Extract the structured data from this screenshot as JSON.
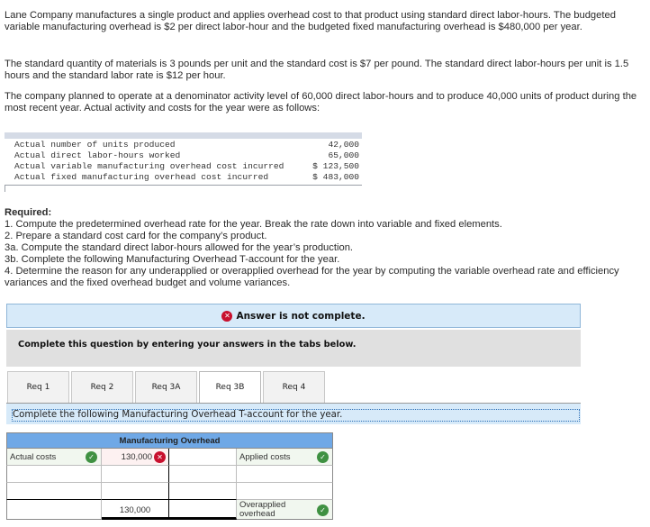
{
  "problem": {
    "paragraphs": [
      "Lane Company manufactures a single product and applies overhead cost to that product using standard direct labor-hours. The budgeted variable manufacturing overhead is $2 per direct labor-hour and the budgeted fixed manufacturing overhead is $480,000 per year.",
      "The standard quantity of materials is 3 pounds per unit and the standard cost is $7 per pound. The standard direct labor-hours per unit is 1.5 hours and the standard labor rate is $12 per hour.",
      "The company planned to operate at a denominator activity level of 60,000 direct labor-hours and to produce 40,000 units of product during the most recent year. Actual activity and costs for the year were as follows:"
    ],
    "actuals": [
      {
        "label": "Actual number of units produced",
        "value": "42,000"
      },
      {
        "label": "Actual direct labor-hours worked",
        "value": "65,000"
      },
      {
        "label": "Actual variable manufacturing overhead cost incurred",
        "value": "$ 123,500"
      },
      {
        "label": "Actual fixed manufacturing overhead cost incurred",
        "value": "$ 483,000"
      }
    ],
    "required": {
      "heading": "Required:",
      "items": [
        "1. Compute the predetermined overhead rate for the year. Break the rate down into variable and fixed elements.",
        "2. Prepare a standard cost card for the company’s product.",
        "3a. Compute the standard direct labor-hours allowed for the year’s production.",
        "3b. Complete the following Manufacturing Overhead T-account for the year.",
        "4. Determine the reason for any underapplied or overapplied overhead for the year by computing the variable overhead rate and efficiency variances and the fixed overhead budget and volume variances."
      ]
    }
  },
  "answer": {
    "status_icon": "x-circle-icon",
    "status_text": "Answer is not complete.",
    "instruction": "Complete this question by entering your answers in the tabs below."
  },
  "tabs": [
    {
      "label": "Req 1",
      "active": false
    },
    {
      "label": "Req 2",
      "active": false
    },
    {
      "label": "Req 3A",
      "active": false
    },
    {
      "label": "Req 3B",
      "active": true
    },
    {
      "label": "Req 4",
      "active": false
    }
  ],
  "tab_panel": {
    "instruction": "Complete the following Manufacturing Overhead T-account for the year."
  },
  "t_account": {
    "title": "Manufacturing Overhead",
    "rows": [
      {
        "debit_label": "Actual costs",
        "debit_label_status": "correct",
        "debit_amount": "130,000",
        "debit_amount_status": "incorrect",
        "credit_amount": "",
        "credit_label": "Applied costs",
        "credit_label_status": "correct"
      },
      {
        "debit_label": "",
        "debit_amount": "",
        "credit_amount": "",
        "credit_label": ""
      },
      {
        "debit_label": "",
        "debit_amount": "",
        "credit_amount": "",
        "credit_label": ""
      },
      {
        "debit_label": "",
        "debit_amount": "130,000",
        "credit_amount": "",
        "credit_label": "Overapplied overhead",
        "credit_label_status": "correct"
      }
    ],
    "colors": {
      "header": "#6fa8e6",
      "correct": "#3f9142",
      "incorrect": "#c8102e"
    }
  }
}
